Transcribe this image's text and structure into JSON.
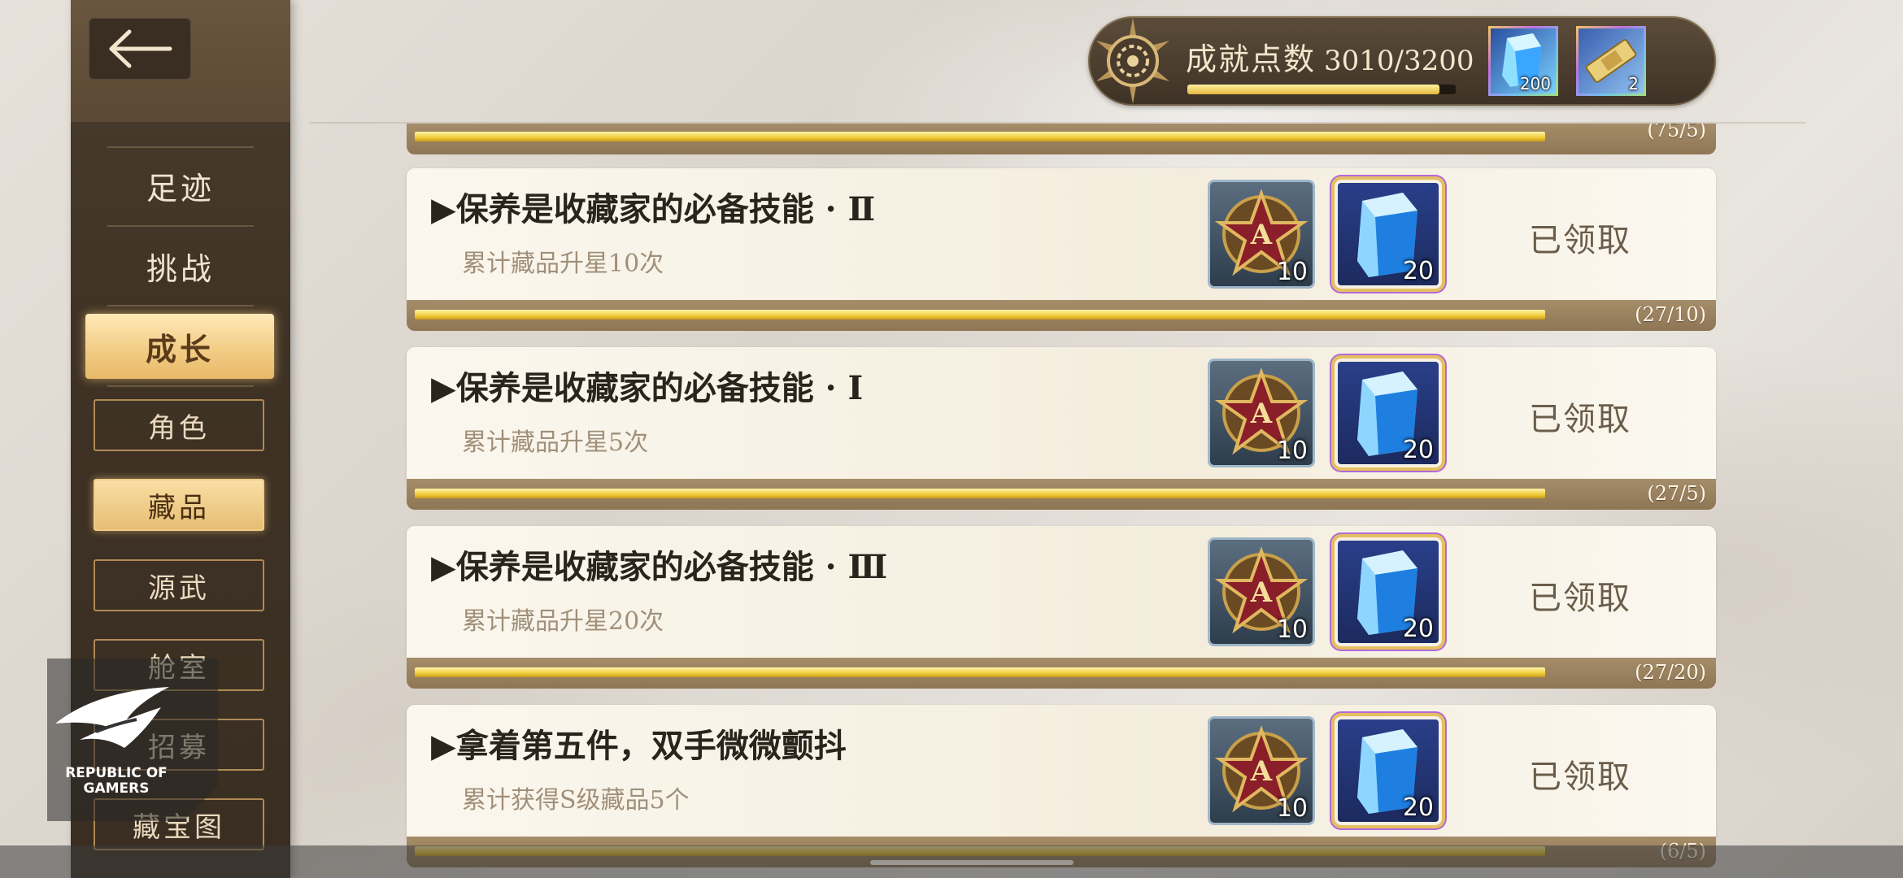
{
  "sidebar": {
    "nav": [
      {
        "label": "足迹"
      },
      {
        "label": "挑战"
      },
      {
        "label": "成长"
      }
    ],
    "sub": [
      {
        "label": "角色"
      },
      {
        "label": "藏品"
      },
      {
        "label": "源武"
      },
      {
        "label": "舱室"
      },
      {
        "label": "招募"
      },
      {
        "label": "藏宝图"
      }
    ]
  },
  "header": {
    "title": "成就点数",
    "value": "3010/3200",
    "progress": 0.94,
    "currencies": [
      {
        "icon": "crystal-icon",
        "count": "200"
      },
      {
        "icon": "ticket-icon",
        "count": "2"
      }
    ]
  },
  "partial_progress": "(75/5)",
  "cards": [
    {
      "title": "▶保养是收藏家的必备技能 · Ⅱ",
      "desc": "累计藏品升星10次",
      "reward1": "10",
      "reward2": "20",
      "status": "已领取",
      "progress_text": "(27/10)",
      "progress": 1.0
    },
    {
      "title": "▶保养是收藏家的必备技能 · Ⅰ",
      "desc": "累计藏品升星5次",
      "reward1": "10",
      "reward2": "20",
      "status": "已领取",
      "progress_text": "(27/5)",
      "progress": 1.0
    },
    {
      "title": "▶保养是收藏家的必备技能 · Ⅲ",
      "desc": "累计藏品升星20次",
      "reward1": "10",
      "reward2": "20",
      "status": "已领取",
      "progress_text": "(27/20)",
      "progress": 1.0
    },
    {
      "title": "▶拿着第五件，双手微微颤抖",
      "desc": "累计获得S级藏品5个",
      "reward1": "10",
      "reward2": "20",
      "status": "已领取",
      "progress_text": "(6/5)",
      "progress": 1.0
    }
  ],
  "watermark": {
    "line1": "REPUBLIC OF",
    "line2": "GAMERS"
  }
}
